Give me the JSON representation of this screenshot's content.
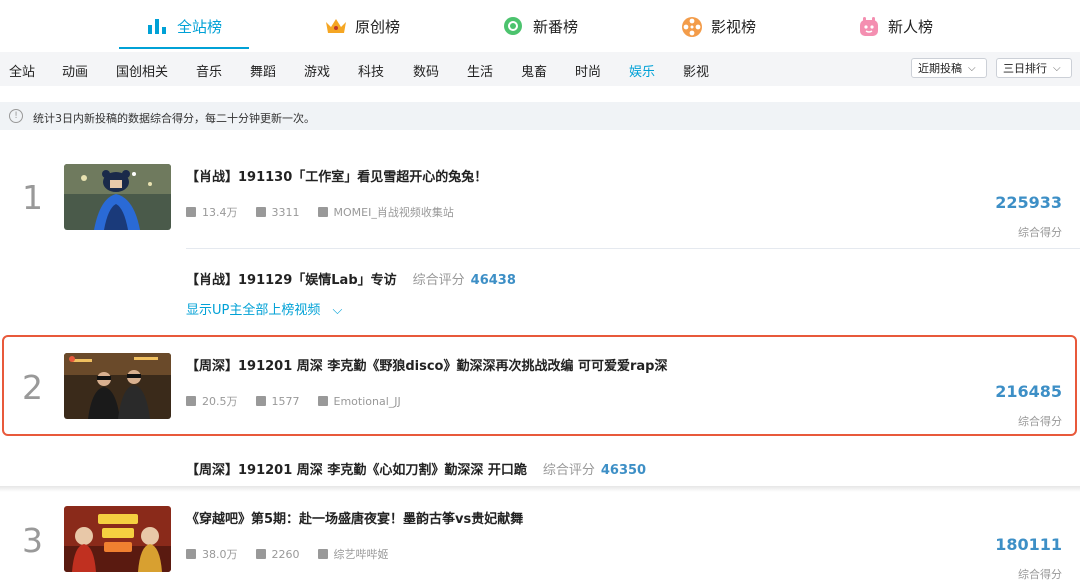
{
  "top_tabs": [
    {
      "label": "全站榜",
      "icon": "bar-chart-icon",
      "active": true
    },
    {
      "label": "原创榜",
      "icon": "crown-icon",
      "active": false
    },
    {
      "label": "新番榜",
      "icon": "ring-icon",
      "active": false
    },
    {
      "label": "影视榜",
      "icon": "film-reel-icon",
      "active": false
    },
    {
      "label": "新人榜",
      "icon": "new-user-icon",
      "active": false
    }
  ],
  "categories": [
    "全站",
    "动画",
    "国创相关",
    "音乐",
    "舞蹈",
    "游戏",
    "科技",
    "数码",
    "生活",
    "鬼畜",
    "时尚",
    "娱乐",
    "影视"
  ],
  "active_category": "娱乐",
  "filters": {
    "recent": "近期投稿",
    "period": "三日排行"
  },
  "notice": "统计3日内新投稿的数据综合得分，每二十分钟更新一次。",
  "score_label": "综合得分",
  "sub_score_label": "综合评分",
  "show_more": "显示UP主全部上榜视频",
  "items": [
    {
      "rank": "1",
      "title": "【肖战】191130「工作室」看见雪超开心的兔兔！",
      "plays": "13.4万",
      "danmaku": "3311",
      "up": "MOMEI_肖战视频收集站",
      "score": "225933",
      "sub": {
        "title": "【肖战】191129「娱情Lab」专访",
        "score": "46438"
      }
    },
    {
      "rank": "2",
      "title": "【周深】191201 周深 李克勤《野狼disco》勤深深再次挑战改编 可可爱爱rap深",
      "plays": "20.5万",
      "danmaku": "1577",
      "up": "Emotional_JJ",
      "score": "216485",
      "sub": {
        "title": "【周深】191201 周深 李克勤《心如刀割》勤深深 开口跪",
        "score": "46350"
      }
    },
    {
      "rank": "3",
      "title": "《穿越吧》第5期：赴一场盛唐夜宴！墨韵古筝vs贵妃献舞",
      "plays": "38.0万",
      "danmaku": "2260",
      "up": "综艺哔哔姬",
      "score": "180111"
    }
  ],
  "colors": {
    "accent": "#00a1d6",
    "score": "#3d8fc6",
    "highlight": "#e8593b"
  }
}
